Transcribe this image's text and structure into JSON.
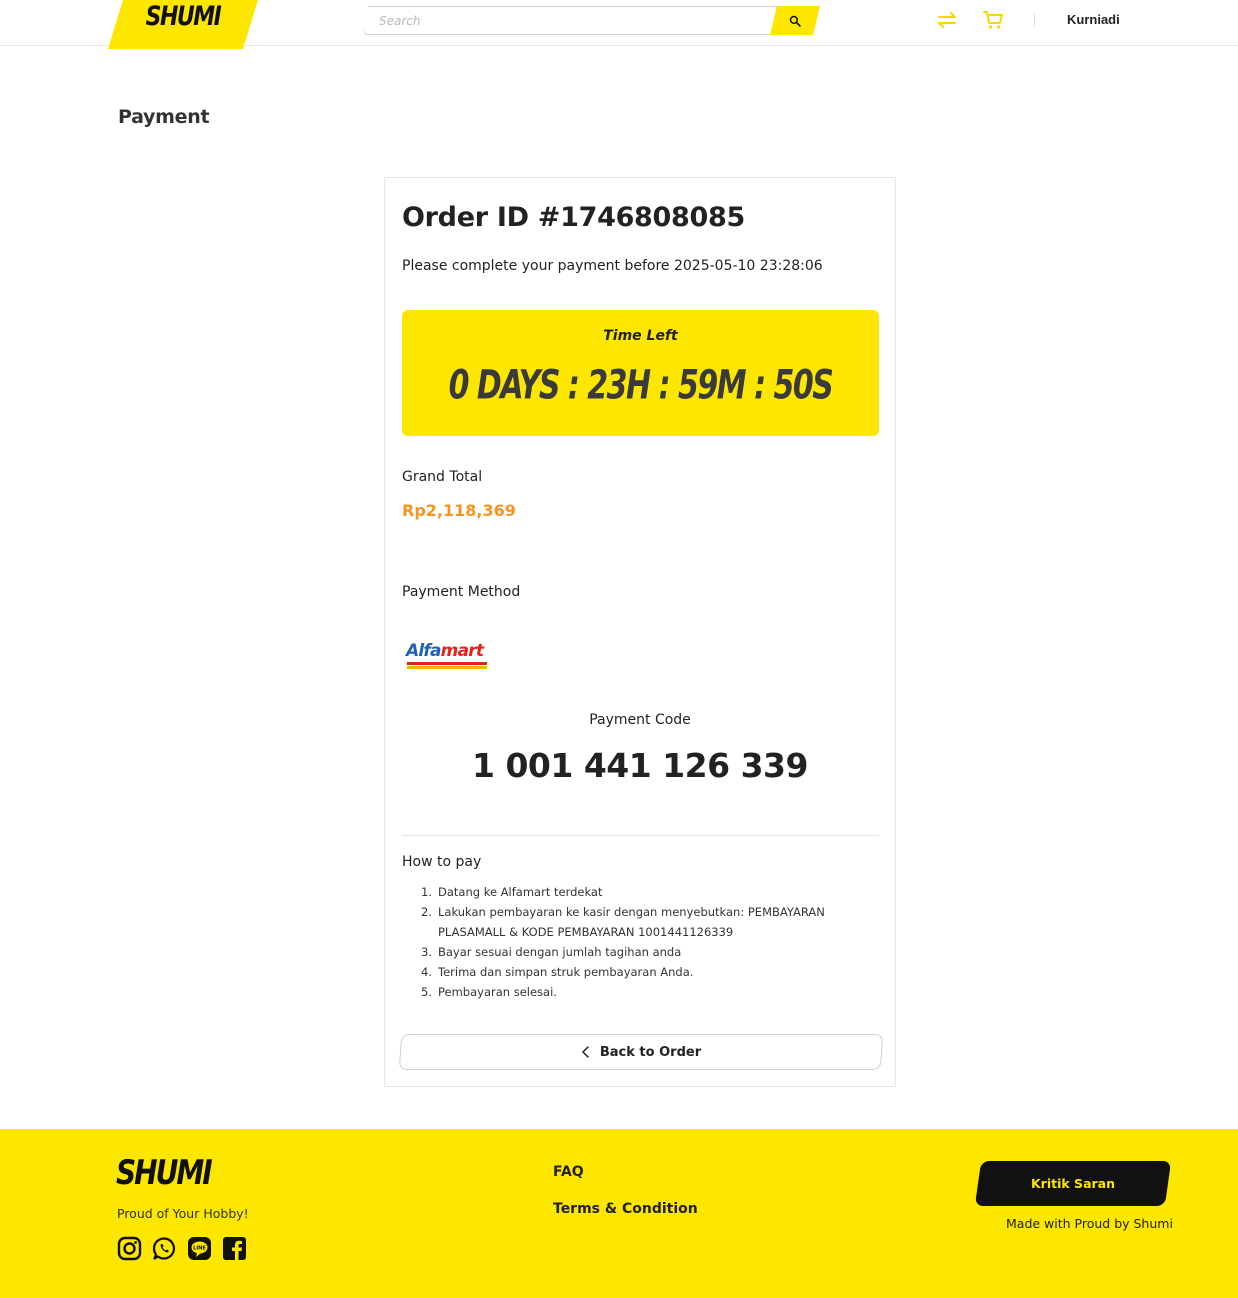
{
  "header": {
    "logo": "SHUMI",
    "search_placeholder": "Search",
    "user_name": "Kurniadi",
    "icons": [
      "compare-icon",
      "cart-icon",
      "search-icon"
    ],
    "accent_color": "#fde600"
  },
  "page": {
    "title": "Payment"
  },
  "order": {
    "id_label": "Order ID #1746808085",
    "deadline_text": "Please complete your payment before 2025-05-10 23:28:06",
    "timer_label": "Time Left",
    "timer_value": "0 DAYS : 23H : 59M : 50S",
    "grand_total_label": "Grand Total",
    "grand_total_value": "Rp2,118,369",
    "grand_total_color": "#f7931e",
    "payment_method_label": "Payment Method",
    "payment_method_logo": {
      "part1": "Alfa",
      "part2": "mart"
    },
    "payment_code_label": "Payment Code",
    "payment_code_value": "1 001 441 126 339",
    "how_to_pay_label": "How to pay",
    "steps": [
      {
        "num": "1.",
        "text": "Datang ke Alfamart terdekat"
      },
      {
        "num": "2.",
        "text": "Lakukan pembayaran ke kasir dengan menyebutkan: PEMBAYARAN PLASAMALL & KODE PEMBAYARAN 1001441126339"
      },
      {
        "num": "3.",
        "text": "Bayar sesuai dengan jumlah tagihan anda"
      },
      {
        "num": "4.",
        "text": "Terima dan simpan struk pembayaran Anda."
      },
      {
        "num": "5.",
        "text": "Pembayaran selesai."
      }
    ],
    "back_button_label": "Back to Order"
  },
  "footer": {
    "logo": "SHUMI",
    "tagline": "Proud of Your Hobby!",
    "social_icons": [
      "instagram-icon",
      "whatsapp-icon",
      "line-icon",
      "facebook-icon"
    ],
    "links": {
      "faq": "FAQ",
      "terms": "Terms & Condition"
    },
    "feedback_button": "Kritik Saran",
    "made_with": "Made with Proud by Shumi"
  }
}
